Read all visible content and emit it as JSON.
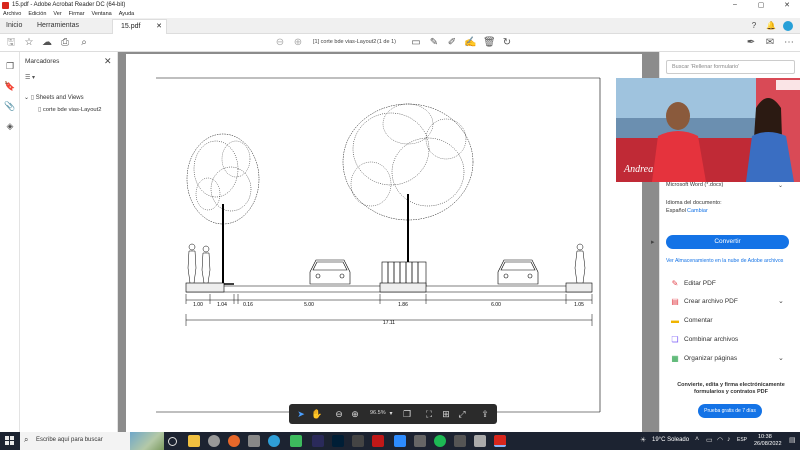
{
  "window": {
    "title": "15.pdf - Adobe Acrobat Reader DC (64-bit)"
  },
  "menu": [
    "Archivo",
    "Edición",
    "Ver",
    "Firmar",
    "Ventana",
    "Ayuda"
  ],
  "tabs": {
    "home": "Inicio",
    "tools": "Herramientas",
    "document": "15.pdf"
  },
  "toolbar": {
    "page_label": "[1] corte bde vias-Layout2",
    "page_count": "(1 de 1)"
  },
  "bookmarks": {
    "title": "Marcadores",
    "options_label": "▾",
    "items": [
      {
        "label": "Sheets and Views"
      },
      {
        "label": "corte bde vias-Layout2"
      }
    ]
  },
  "drawing": {
    "dimensions": [
      "1.00",
      "1.04",
      "0.16",
      "5.00",
      "1.86",
      "6.00",
      "1.05"
    ],
    "total": "17.11"
  },
  "floating_toolbar": {
    "zoom": "96.5%"
  },
  "right_panel": {
    "search_placeholder": "Buscar 'Rellenar formulario'",
    "format_value": "Microsoft Word (*.docx)",
    "language_label": "Idioma del documento:",
    "language_value": "Español",
    "language_change": "Cambiar",
    "convert_button": "Convertir",
    "cloud_link": "Ver Almacenamiento en la nube de Adobe archivos",
    "tools": [
      {
        "label": "Editar PDF",
        "icon": "edit-pdf-icon",
        "color": "#e34850"
      },
      {
        "label": "Crear archivo PDF",
        "icon": "create-pdf-icon",
        "color": "#e34850"
      },
      {
        "label": "Comentar",
        "icon": "comment-icon",
        "color": "#f0b400"
      },
      {
        "label": "Combinar archivos",
        "icon": "combine-icon",
        "color": "#7a5af8"
      },
      {
        "label": "Organizar páginas",
        "icon": "organize-icon",
        "color": "#2da44e"
      }
    ],
    "promo_text": "Convierte, edita y firma electrónicamente formularios y contratos PDF",
    "promo_button": "Prueba gratis de 7 días"
  },
  "webcam": {
    "caption": "Andrea"
  },
  "taskbar": {
    "search_placeholder": "Escribe aquí para buscar",
    "weather": "19°C  Soleado",
    "language": "ESP",
    "time": "10:38",
    "date": "26/08/2022"
  },
  "colors": {
    "accent": "#1473e6",
    "taskbar": "#1c2331"
  }
}
